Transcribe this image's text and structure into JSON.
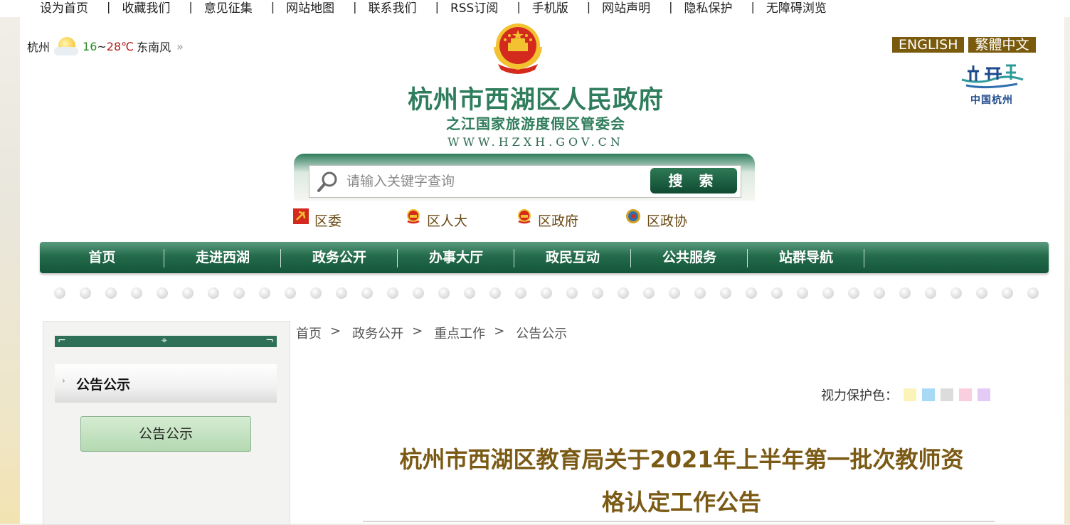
{
  "topbar": {
    "links": [
      "设为首页",
      "收藏我们",
      "意见征集",
      "网站地图",
      "联系我们",
      "RSS订阅",
      "手机版",
      "网站声明",
      "隐私保护",
      "无障碍浏览"
    ]
  },
  "weather": {
    "city": "杭州",
    "low": "16",
    "tilde": "~",
    "high": "28℃",
    "wind": "东南风",
    "icon": "sun-cloud-icon",
    "more": "»"
  },
  "header": {
    "title": "杭州市西湖区人民政府",
    "subtitle": "之江国家旅游度假区管委会",
    "url": "WWW.HZXH.GOV.CN",
    "hz_logo_caption": "中国杭州"
  },
  "lang": {
    "english": "ENGLISH",
    "traditional": "繁體中文"
  },
  "search": {
    "placeholder": "请输入关键字查询",
    "button": "搜 索"
  },
  "orgs": [
    {
      "label": "区委",
      "icon": "party-emblem-icon"
    },
    {
      "label": "区人大",
      "icon": "national-emblem-icon"
    },
    {
      "label": "区政府",
      "icon": "national-emblem-icon"
    },
    {
      "label": "区政协",
      "icon": "cppcc-emblem-icon"
    }
  ],
  "nav": [
    "首页",
    "走进西湖",
    "政务公开",
    "办事大厅",
    "政民互动",
    "公共服务",
    "站群导航"
  ],
  "sidebar": {
    "heading": "公告公示",
    "button": "公告公示"
  },
  "breadcrumb": [
    "首页",
    "政务公开",
    "重点工作",
    "公告公示"
  ],
  "breadcrumb_sep": ">",
  "eye_protection": {
    "label": "视力保护色：",
    "colors": [
      "#fbf4b8",
      "#a8daf5",
      "#dcdcdc",
      "#f9cfe0",
      "#e4cbf5"
    ]
  },
  "article": {
    "title_line1": "杭州市西湖区教育局关于2021年上半年第一批次教师资",
    "title_line2": "格认定工作公告"
  },
  "colors": {
    "brand_green": "#2f7d5d",
    "nav_green": "#14553a",
    "title_brown": "#7a5a14",
    "lang_bg": "#7a5b0e"
  }
}
